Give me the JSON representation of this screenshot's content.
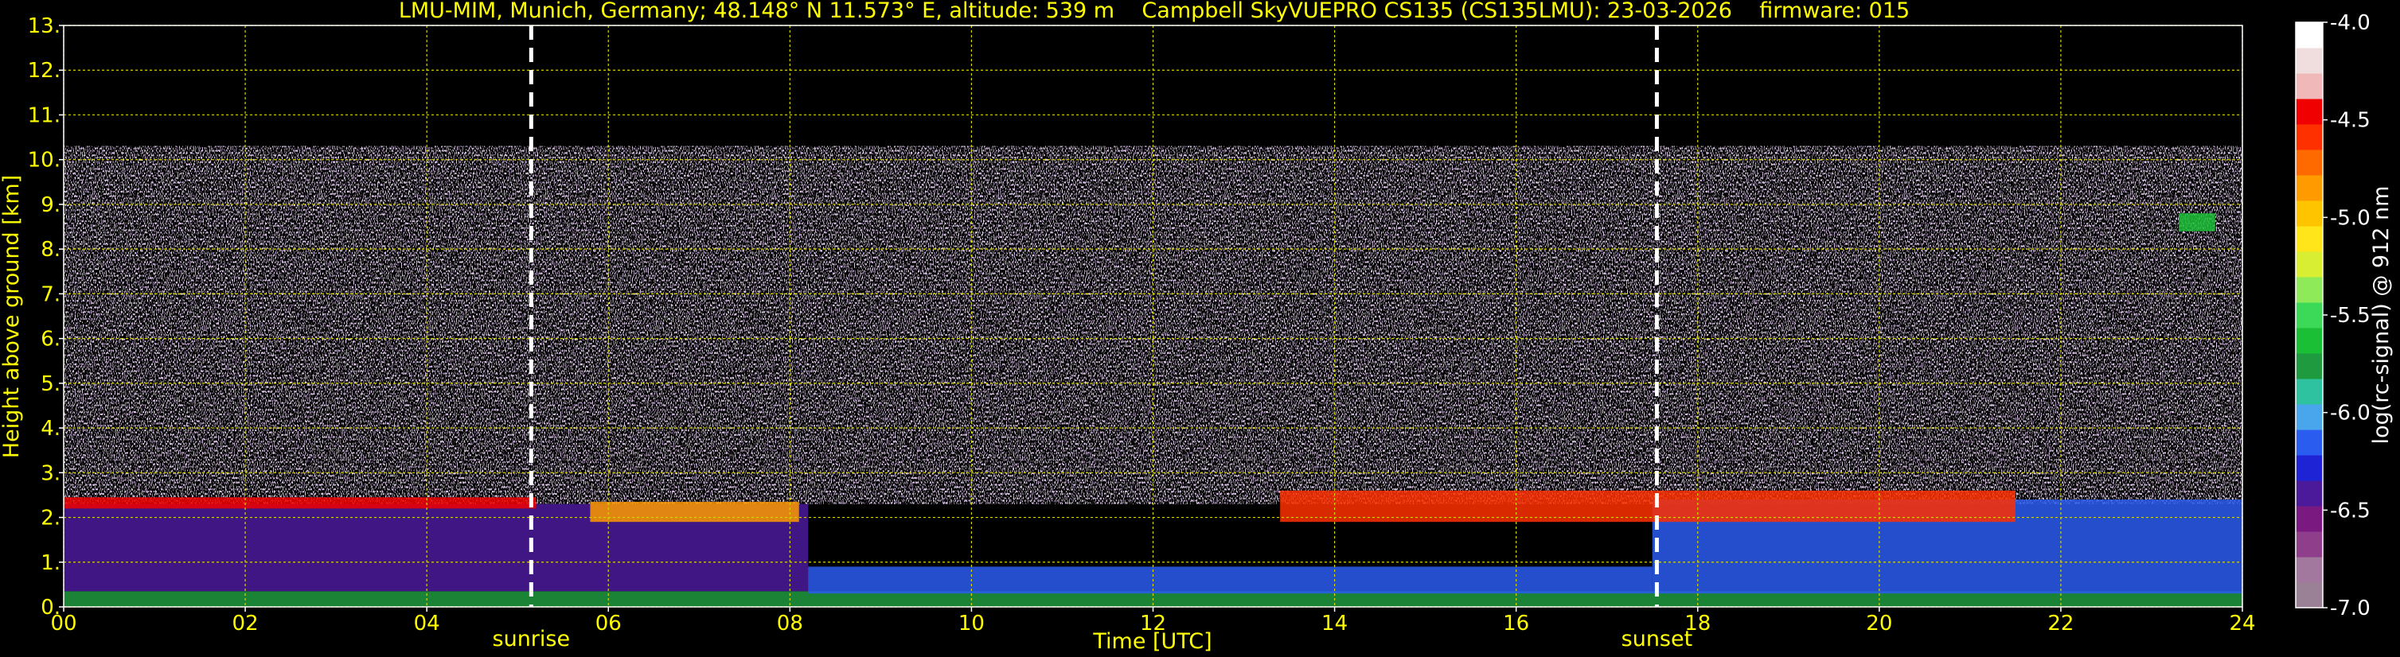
{
  "chart_data": {
    "type": "heatmap",
    "title": "LMU-MIM, Munich, Germany; 48.148° N 11.573° E, altitude: 539 m    Campbell SkyVUEPRO CS135 (CS135LMU): 23-03-2026    firmware: 015",
    "xlabel": "Time [UTC]",
    "ylabel": "Height above ground [km]",
    "xlim": [
      0,
      24
    ],
    "ylim": [
      0,
      13
    ],
    "x_ticks": [
      "00",
      "02",
      "04",
      "06",
      "08",
      "10",
      "12",
      "14",
      "16",
      "18",
      "20",
      "22",
      "24"
    ],
    "y_ticks": [
      "0.",
      "1.",
      "2.",
      "3.",
      "4.",
      "5.",
      "6.",
      "7.",
      "8.",
      "9.",
      "10.",
      "11.",
      "12.",
      "13."
    ],
    "grid": true,
    "markers": [
      {
        "label": "sunrise",
        "x": 5.15
      },
      {
        "label": "sunset",
        "x": 17.55
      }
    ],
    "colorbar": {
      "label": "log(rc-signal) @ 912 nm",
      "range": [
        -7.0,
        -4.0
      ],
      "ticks": [
        "-4.0",
        "-4.5",
        "-5.0",
        "-5.5",
        "-6.0",
        "-6.5",
        "-7.0"
      ],
      "colors": [
        "#9a8196",
        "#a2789e",
        "#8f3e8b",
        "#7a1a80",
        "#4a1a9a",
        "#1f23d6",
        "#2a5cf0",
        "#4aa6ec",
        "#2ec2a0",
        "#1f9a3e",
        "#1bbf36",
        "#3cd858",
        "#8fea5a",
        "#d7ee32",
        "#ffe51a",
        "#ffc400",
        "#ff9a00",
        "#ff6a00",
        "#ff3000",
        "#f00000",
        "#f0b8b8",
        "#f0dede",
        "#ffffff"
      ]
    },
    "features": [
      {
        "name": "surface aerosol layer",
        "start": 0,
        "end": 24,
        "bottom": 0.0,
        "top": 0.35,
        "value": -5.7
      },
      {
        "name": "boundary layer",
        "start": 0,
        "end": 8.2,
        "bottom": 0.35,
        "top": 2.3,
        "value": -6.4
      },
      {
        "name": "boundary layer",
        "start": 8.2,
        "end": 17.5,
        "bottom": 0.3,
        "top": 0.9,
        "value": -6.2
      },
      {
        "name": "boundary layer",
        "start": 17.5,
        "end": 24,
        "bottom": 0.3,
        "top": 2.4,
        "value": -6.1
      },
      {
        "name": "cloud base",
        "start": 5.8,
        "end": 8.1,
        "bottom": 1.9,
        "top": 2.35,
        "value": -4.9
      },
      {
        "name": "cloud base",
        "start": 13.4,
        "end": 21.5,
        "bottom": 1.9,
        "top": 2.6,
        "value": -4.6
      },
      {
        "name": "thin cloud",
        "start": 0,
        "end": 5.2,
        "bottom": 2.2,
        "top": 2.45,
        "value": -4.4
      },
      {
        "name": "small cloud",
        "start": 23.3,
        "end": 23.7,
        "bottom": 8.4,
        "top": 8.8,
        "value": -5.6
      }
    ],
    "signal_ceiling": 10.3
  }
}
